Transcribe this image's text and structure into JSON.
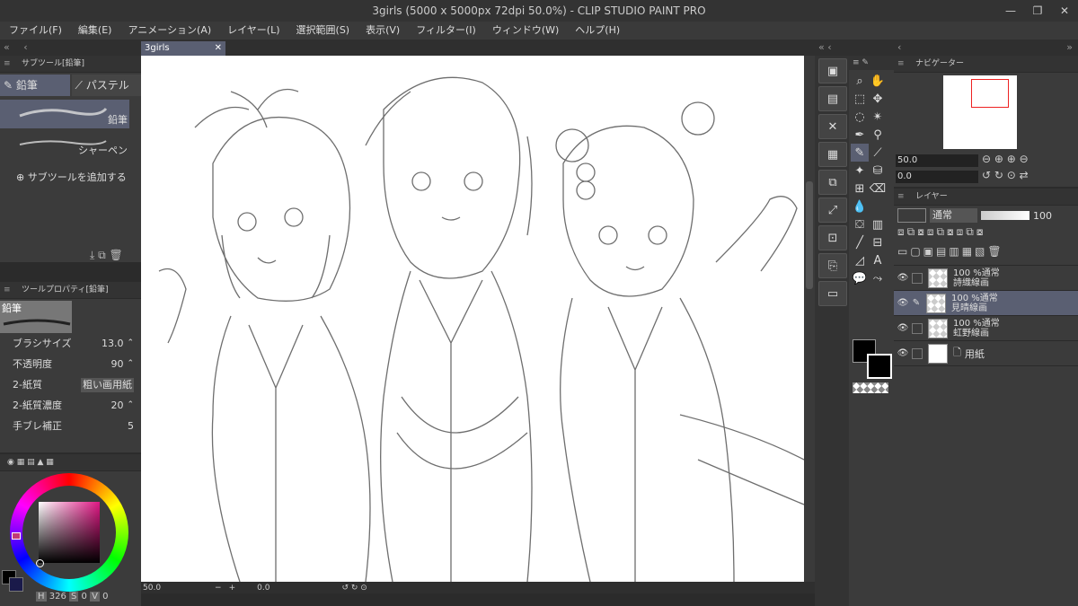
{
  "window": {
    "title": "3girls (5000 x 5000px 72dpi 50.0%) - CLIP STUDIO PAINT PRO",
    "min": "—",
    "max": "❐",
    "close": "✕"
  },
  "menu": [
    "ファイル(F)",
    "編集(E)",
    "アニメーション(A)",
    "レイヤー(L)",
    "選択範囲(S)",
    "表示(V)",
    "フィルター(I)",
    "ウィンドウ(W)",
    "ヘルプ(H)"
  ],
  "doc_tab": {
    "label": "3girls",
    "close": "✕"
  },
  "subtool": {
    "header": "サブツール[鉛筆]",
    "tabs": [
      "鉛筆",
      "パステル"
    ],
    "items": [
      "鉛筆",
      "シャーペン"
    ],
    "add": "サブツールを追加する"
  },
  "toolprop": {
    "header": "ツールプロパティ[鉛筆]",
    "preview_label": "鉛筆",
    "rows": [
      {
        "label": "ブラシサイズ",
        "value": "13.0"
      },
      {
        "label": "不透明度",
        "value": "90"
      },
      {
        "label": "2-紙質",
        "value": "粗い画用紙"
      },
      {
        "label": "2-紙質濃度",
        "value": "20"
      },
      {
        "label": "手ブレ補正",
        "value": "5"
      }
    ]
  },
  "color": {
    "h_label": "H",
    "h": "326",
    "s_label": "S",
    "s": "0",
    "v_label": "V",
    "v": "0",
    "indicator_color": "#c23a78"
  },
  "canvas_status": {
    "zoom": "50.0",
    "minus": "−",
    "plus": "+",
    "angle": "0.0"
  },
  "navigator": {
    "header": "ナビゲーター",
    "zoom": "50.0",
    "angle": "0.0"
  },
  "layers": {
    "header": "レイヤー",
    "blend": "通常",
    "opacity": "100",
    "items": [
      {
        "line1": "100 %通常",
        "line2": "詩織線画",
        "selected": false
      },
      {
        "line1": "100 %通常",
        "line2": "見晴線画",
        "selected": true
      },
      {
        "line1": "100 %通常",
        "line2": "虹野線画",
        "selected": false
      }
    ],
    "paper": "用紙"
  }
}
